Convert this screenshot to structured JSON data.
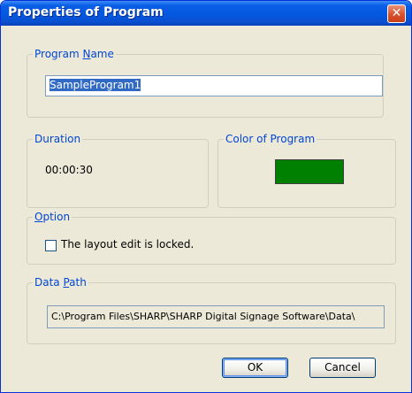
{
  "window": {
    "title": "Properties of Program",
    "close_glyph": "✕"
  },
  "program_name": {
    "legend_prefix": "Program ",
    "legend_accel": "N",
    "legend_suffix": "ame",
    "value": "SampleProgram1"
  },
  "duration": {
    "legend": "Duration",
    "value": "00:00:30"
  },
  "color_of_program": {
    "legend": "Color of Program",
    "color": "#008000"
  },
  "option": {
    "legend_accel": "O",
    "legend_suffix": "ption",
    "checkbox_label": "The layout edit is locked.",
    "checked": false
  },
  "data_path": {
    "legend_prefix": "Data ",
    "legend_accel": "P",
    "legend_suffix": "ath",
    "value": "C:\\Program Files\\SHARP\\SHARP Digital Signage Software\\Data\\"
  },
  "buttons": {
    "ok": "OK",
    "cancel": "Cancel"
  },
  "icons": {
    "close": "close-icon"
  }
}
